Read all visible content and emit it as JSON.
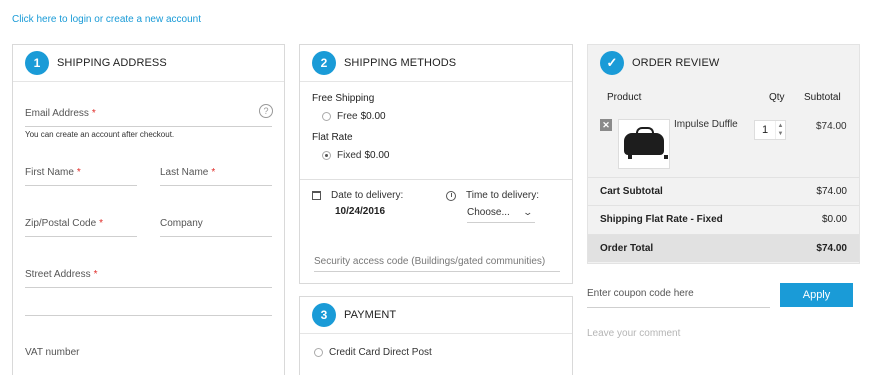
{
  "login_link": "Click here to login or create a new account",
  "address": {
    "step": "1",
    "title": "SHIPPING ADDRESS",
    "email_label": "Email Address",
    "help": "?",
    "hint": "You can create an account after checkout.",
    "first_name": "First Name",
    "last_name": "Last Name",
    "zip": "Zip/Postal Code",
    "company": "Company",
    "street": "Street Address",
    "vat": "VAT number",
    "required_mark": "*"
  },
  "methods": {
    "step": "2",
    "title": "SHIPPING METHODS",
    "group1": "Free Shipping",
    "opt1_label": "Free",
    "opt1_price": "$0.00",
    "group2": "Flat Rate",
    "opt2_label": "Fixed",
    "opt2_price": "$0.00",
    "date_label": "Date to delivery:",
    "date_value": "10/24/2016",
    "time_label": "Time to delivery:",
    "time_value": "Choose...",
    "security_placeholder": "Security access code (Buildings/gated communities)"
  },
  "payment": {
    "step": "3",
    "title": "PAYMENT",
    "option": "Credit Card Direct Post"
  },
  "review": {
    "step_icon": "✓",
    "title": "ORDER REVIEW",
    "col_product": "Product",
    "col_qty": "Qty",
    "col_subtotal": "Subtotal",
    "remove": "✕",
    "product_name": "Impulse Duffle",
    "qty": "1",
    "line_subtotal": "$74.00",
    "cart_subtotal_label": "Cart Subtotal",
    "cart_subtotal": "$74.00",
    "shipping_label": "Shipping Flat Rate - Fixed",
    "shipping": "$0.00",
    "total_label": "Order Total",
    "total": "$74.00"
  },
  "coupon": {
    "placeholder": "Enter coupon code here",
    "apply": "Apply"
  },
  "comment_placeholder": "Leave your comment",
  "colors": {
    "accent": "#1a9bd7",
    "required": "#e02b27"
  }
}
